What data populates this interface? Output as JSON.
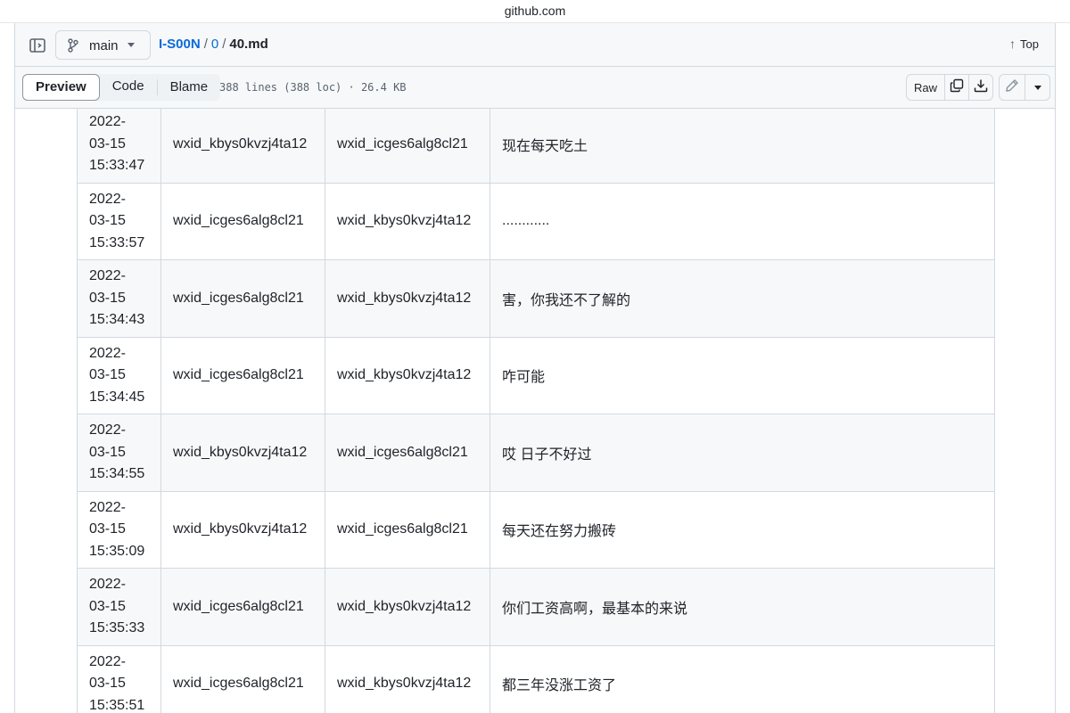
{
  "browser": {
    "url": "github.com"
  },
  "file_header": {
    "branch": "main",
    "breadcrumb": {
      "repo": "I-S00N",
      "folder": "0",
      "file": "40.md",
      "sep": "/"
    },
    "top_label": "Top"
  },
  "toolbar": {
    "tabs": {
      "preview": "Preview",
      "code": "Code",
      "blame": "Blame"
    },
    "file_meta": "388 lines (388 loc) · 26.4 KB",
    "raw_label": "Raw"
  },
  "table": {
    "rows": [
      {
        "date": [
          "2022-",
          "03-15",
          "15:33:47"
        ],
        "from": "wxid_kbys0kvzj4ta12",
        "to": "wxid_icges6alg8cl21",
        "message": "现在每天吃土"
      },
      {
        "date": [
          "2022-",
          "03-15",
          "15:33:57"
        ],
        "from": "wxid_icges6alg8cl21",
        "to": "wxid_kbys0kvzj4ta12",
        "message": "............"
      },
      {
        "date": [
          "2022-",
          "03-15",
          "15:34:43"
        ],
        "from": "wxid_icges6alg8cl21",
        "to": "wxid_kbys0kvzj4ta12",
        "message": "害，你我还不了解的"
      },
      {
        "date": [
          "2022-",
          "03-15",
          "15:34:45"
        ],
        "from": "wxid_icges6alg8cl21",
        "to": "wxid_kbys0kvzj4ta12",
        "message": "咋可能"
      },
      {
        "date": [
          "2022-",
          "03-15",
          "15:34:55"
        ],
        "from": "wxid_kbys0kvzj4ta12",
        "to": "wxid_icges6alg8cl21",
        "message": "哎 日子不好过"
      },
      {
        "date": [
          "2022-",
          "03-15",
          "15:35:09"
        ],
        "from": "wxid_kbys0kvzj4ta12",
        "to": "wxid_icges6alg8cl21",
        "message": "每天还在努力搬砖"
      },
      {
        "date": [
          "2022-",
          "03-15",
          "15:35:33"
        ],
        "from": "wxid_icges6alg8cl21",
        "to": "wxid_kbys0kvzj4ta12",
        "message": "你们工资高啊，最基本的来说"
      },
      {
        "date": [
          "2022-",
          "03-15",
          "15:35:51"
        ],
        "from": "wxid_icges6alg8cl21",
        "to": "wxid_kbys0kvzj4ta12",
        "message": "都三年没涨工资了"
      }
    ]
  }
}
